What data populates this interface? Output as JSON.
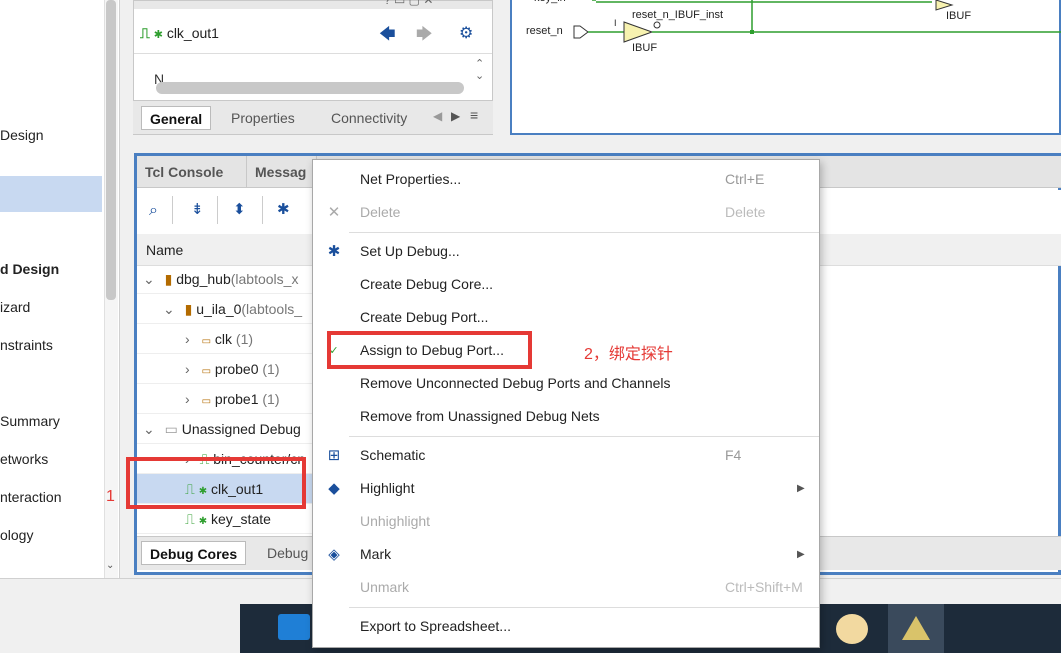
{
  "left_nav": {
    "items": [
      {
        "label": "Design",
        "bold": false
      },
      {
        "label": "d Design",
        "bold": true
      },
      {
        "label": "izard",
        "bold": false
      },
      {
        "label": "nstraints",
        "bold": false
      },
      {
        "label": "Summary",
        "bold": false
      },
      {
        "label": "etworks",
        "bold": false
      },
      {
        "label": "nteraction",
        "bold": false
      },
      {
        "label": "ology",
        "bold": false
      }
    ]
  },
  "properties_panel": {
    "net_name": "clk_out1",
    "body_text": "N",
    "tabs": [
      "General",
      "Properties",
      "Connectivity"
    ],
    "active_tab": "General"
  },
  "schematic": {
    "labels": {
      "key_in": "key_in",
      "reset_n": "reset_n",
      "inst": "reset_n_IBUF_inst",
      "pin_i": "I",
      "pin_o": "O",
      "ibuf1": "IBUF",
      "ibuf2": "IBUF"
    }
  },
  "debug_panel": {
    "tabs": [
      "Tcl Console",
      "Messag"
    ],
    "tree_header": "Name",
    "rows": [
      {
        "name": "dbg_hub",
        "suffix": "(labtools_x",
        "level": 0
      },
      {
        "name": "u_ila_0",
        "suffix": "(labtools_",
        "level": 1
      },
      {
        "name": "clk",
        "suffix": " (1)",
        "level": 2
      },
      {
        "name": "probe0",
        "suffix": " (1)",
        "level": 2
      },
      {
        "name": "probe1",
        "suffix": " (1)",
        "level": 2
      },
      {
        "name": "Unassigned Debug",
        "suffix": "",
        "level": 0
      },
      {
        "name": "bin_counter/cn",
        "suffix": "",
        "level": 1
      },
      {
        "name": "clk_out1",
        "suffix": "",
        "level": 1
      },
      {
        "name": "key_state",
        "suffix": "",
        "level": 1
      }
    ],
    "bottom_tabs": [
      "Debug Cores",
      "Debug"
    ],
    "active_bottom_tab": "Debug Cores"
  },
  "context_menu": {
    "items": {
      "net_properties": {
        "label": "Net Properties...",
        "shortcut": "Ctrl+E"
      },
      "delete": {
        "label": "Delete",
        "shortcut": "Delete"
      },
      "set_up_debug": {
        "label": "Set Up Debug..."
      },
      "create_debug_core": {
        "label": "Create Debug Core..."
      },
      "create_debug_port": {
        "label": "Create Debug Port..."
      },
      "assign_to_debug_port": {
        "label": "Assign to Debug Port..."
      },
      "remove_unconnected": {
        "label": "Remove Unconnected Debug Ports and Channels"
      },
      "remove_from_unassigned": {
        "label": "Remove from Unassigned Debug Nets"
      },
      "schematic": {
        "label": "Schematic",
        "shortcut": "F4"
      },
      "highlight": {
        "label": "Highlight"
      },
      "unhighlight": {
        "label": "Unhighlight"
      },
      "mark": {
        "label": "Mark"
      },
      "unmark": {
        "label": "Unmark",
        "shortcut": "Ctrl+Shift+M"
      },
      "export": {
        "label": "Export to Spreadsheet..."
      }
    }
  },
  "annotations": {
    "step1": "1",
    "step2": "2，绑定探针"
  },
  "colors": {
    "accent_blue": "#4a7fc1",
    "selection": "#c8d9f1",
    "annotation_red": "#e53935",
    "net_green": "#2e9e2e"
  }
}
